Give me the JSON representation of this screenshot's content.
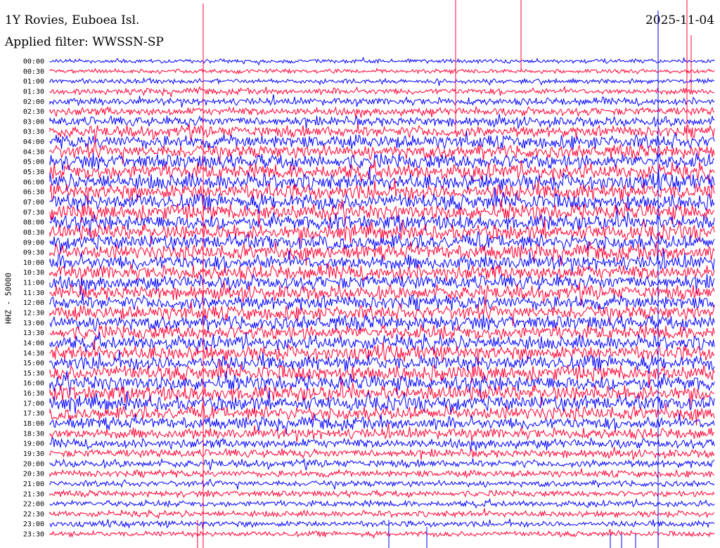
{
  "header": {
    "title": "1Y Rovies, Euboea Isl.",
    "date": "2025-11-04",
    "filter": "Applied filter: WWSSN-SP"
  },
  "chart_data": {
    "type": "line",
    "subtype": "helicorder",
    "ylabel": "HHZ - 50000",
    "row_labels": [
      "00:00",
      "00:30",
      "01:00",
      "01:30",
      "02:00",
      "02:30",
      "03:00",
      "03:30",
      "04:00",
      "04:30",
      "05:00",
      "05:30",
      "06:00",
      "06:30",
      "07:00",
      "07:30",
      "08:00",
      "08:30",
      "09:00",
      "09:30",
      "10:00",
      "10:30",
      "11:00",
      "11:30",
      "12:00",
      "12:30",
      "13:00",
      "13:30",
      "14:00",
      "14:30",
      "15:00",
      "15:30",
      "16:00",
      "16:30",
      "17:00",
      "17:30",
      "18:00",
      "18:30",
      "19:00",
      "19:30",
      "20:00",
      "20:30",
      "21:00",
      "21:30",
      "22:00",
      "22:30",
      "23:00",
      "23:30"
    ],
    "trace_colors": [
      "#0000ff",
      "#ff0033"
    ],
    "relative_amplitude": [
      0.3,
      0.3,
      0.35,
      0.45,
      0.55,
      0.6,
      0.7,
      0.85,
      1.0,
      1.0,
      1.1,
      1.15,
      1.2,
      1.2,
      1.2,
      1.2,
      1.15,
      1.15,
      1.1,
      1.1,
      1.1,
      1.1,
      1.05,
      1.05,
      1.05,
      1.05,
      1.05,
      1.05,
      1.05,
      1.1,
      1.1,
      1.15,
      1.15,
      1.15,
      1.1,
      1.0,
      0.9,
      0.8,
      0.7,
      0.6,
      0.55,
      0.5,
      0.45,
      0.45,
      0.45,
      0.45,
      0.45,
      0.4
    ],
    "grid": false,
    "legend": "none"
  }
}
